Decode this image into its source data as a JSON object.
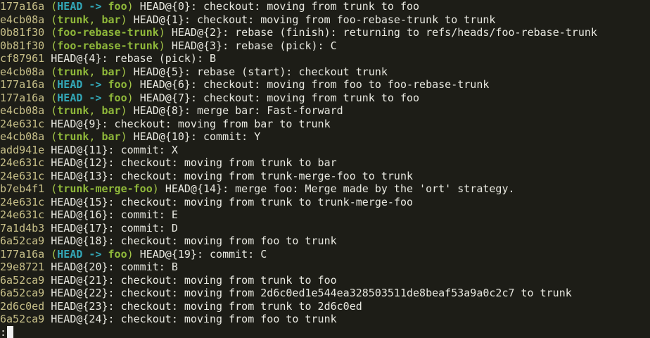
{
  "terminal": {
    "prompt": ":",
    "entries": [
      {
        "hash": "177a16a",
        "refs": [
          {
            "text": "HEAD -> ",
            "kind": "head"
          },
          {
            "text": "foo",
            "kind": "branch"
          }
        ],
        "reflog": "HEAD@{0}",
        "message": ": checkout: moving from trunk to foo"
      },
      {
        "hash": "e4cb08a",
        "refs": [
          {
            "text": "trunk",
            "kind": "branch"
          },
          {
            "text": ", ",
            "kind": "sep"
          },
          {
            "text": "bar",
            "kind": "branch"
          }
        ],
        "reflog": "HEAD@{1}",
        "message": ": checkout: moving from foo-rebase-trunk to trunk"
      },
      {
        "hash": "0b81f30",
        "refs": [
          {
            "text": "foo-rebase-trunk",
            "kind": "branch"
          }
        ],
        "reflog": "HEAD@{2}",
        "message": ": rebase (finish): returning to refs/heads/foo-rebase-trunk"
      },
      {
        "hash": "0b81f30",
        "refs": [
          {
            "text": "foo-rebase-trunk",
            "kind": "branch"
          }
        ],
        "reflog": "HEAD@{3}",
        "message": ": rebase (pick): C"
      },
      {
        "hash": "cf87961",
        "refs": [],
        "reflog": "HEAD@{4}",
        "message": ": rebase (pick): B"
      },
      {
        "hash": "e4cb08a",
        "refs": [
          {
            "text": "trunk",
            "kind": "branch"
          },
          {
            "text": ", ",
            "kind": "sep"
          },
          {
            "text": "bar",
            "kind": "branch"
          }
        ],
        "reflog": "HEAD@{5}",
        "message": ": rebase (start): checkout trunk"
      },
      {
        "hash": "177a16a",
        "refs": [
          {
            "text": "HEAD -> ",
            "kind": "head"
          },
          {
            "text": "foo",
            "kind": "branch"
          }
        ],
        "reflog": "HEAD@{6}",
        "message": ": checkout: moving from foo to foo-rebase-trunk"
      },
      {
        "hash": "177a16a",
        "refs": [
          {
            "text": "HEAD -> ",
            "kind": "head"
          },
          {
            "text": "foo",
            "kind": "branch"
          }
        ],
        "reflog": "HEAD@{7}",
        "message": ": checkout: moving from trunk to foo"
      },
      {
        "hash": "e4cb08a",
        "refs": [
          {
            "text": "trunk",
            "kind": "branch"
          },
          {
            "text": ", ",
            "kind": "sep"
          },
          {
            "text": "bar",
            "kind": "branch"
          }
        ],
        "reflog": "HEAD@{8}",
        "message": ": merge bar: Fast-forward"
      },
      {
        "hash": "24e631c",
        "refs": [],
        "reflog": "HEAD@{9}",
        "message": ": checkout: moving from bar to trunk"
      },
      {
        "hash": "e4cb08a",
        "refs": [
          {
            "text": "trunk",
            "kind": "branch"
          },
          {
            "text": ", ",
            "kind": "sep"
          },
          {
            "text": "bar",
            "kind": "branch"
          }
        ],
        "reflog": "HEAD@{10}",
        "message": ": commit: Y"
      },
      {
        "hash": "add941e",
        "refs": [],
        "reflog": "HEAD@{11}",
        "message": ": commit: X"
      },
      {
        "hash": "24e631c",
        "refs": [],
        "reflog": "HEAD@{12}",
        "message": ": checkout: moving from trunk to bar"
      },
      {
        "hash": "24e631c",
        "refs": [],
        "reflog": "HEAD@{13}",
        "message": ": checkout: moving from trunk-merge-foo to trunk"
      },
      {
        "hash": "b7eb4f1",
        "refs": [
          {
            "text": "trunk-merge-foo",
            "kind": "branch"
          }
        ],
        "reflog": "HEAD@{14}",
        "message": ": merge foo: Merge made by the 'ort' strategy."
      },
      {
        "hash": "24e631c",
        "refs": [],
        "reflog": "HEAD@{15}",
        "message": ": checkout: moving from trunk to trunk-merge-foo"
      },
      {
        "hash": "24e631c",
        "refs": [],
        "reflog": "HEAD@{16}",
        "message": ": commit: E"
      },
      {
        "hash": "7a1d4b3",
        "refs": [],
        "reflog": "HEAD@{17}",
        "message": ": commit: D"
      },
      {
        "hash": "6a52ca9",
        "refs": [],
        "reflog": "HEAD@{18}",
        "message": ": checkout: moving from foo to trunk"
      },
      {
        "hash": "177a16a",
        "refs": [
          {
            "text": "HEAD -> ",
            "kind": "head"
          },
          {
            "text": "foo",
            "kind": "branch"
          }
        ],
        "reflog": "HEAD@{19}",
        "message": ": commit: C"
      },
      {
        "hash": "29e8721",
        "refs": [],
        "reflog": "HEAD@{20}",
        "message": ": commit: B"
      },
      {
        "hash": "6a52ca9",
        "refs": [],
        "reflog": "HEAD@{21}",
        "message": ": checkout: moving from trunk to foo"
      },
      {
        "hash": "6a52ca9",
        "refs": [],
        "reflog": "HEAD@{22}",
        "message": ": checkout: moving from 2d6c0ed1e544ea328503511de8beaf53a9a0c2c7 to trunk"
      },
      {
        "hash": "2d6c0ed",
        "refs": [],
        "reflog": "HEAD@{23}",
        "message": ": checkout: moving from trunk to 2d6c0ed"
      },
      {
        "hash": "6a52ca9",
        "refs": [],
        "reflog": "HEAD@{24}",
        "message": ": checkout: moving from foo to trunk"
      }
    ]
  },
  "colors": {
    "background": "#1d1d17",
    "foreground": "#e8e8e0",
    "hash": "#c8c089",
    "head": "#33a8b8",
    "branch": "#8fb83a"
  }
}
